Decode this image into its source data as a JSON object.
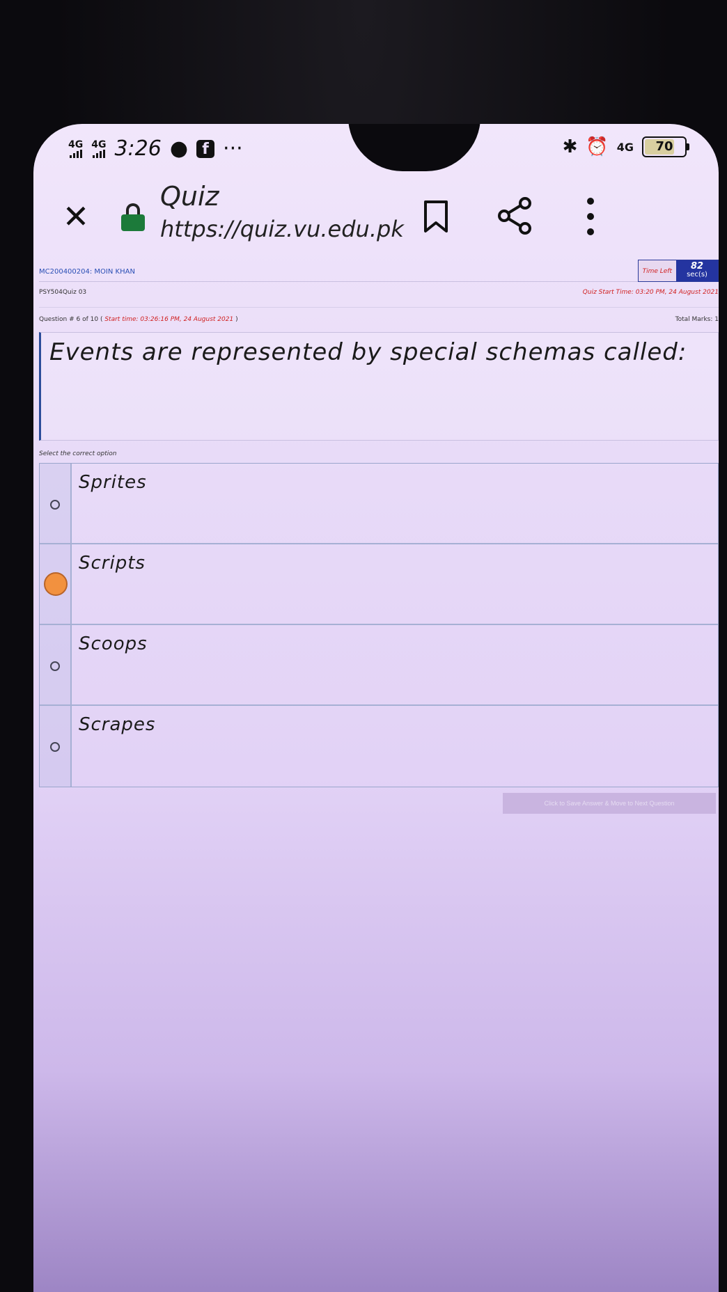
{
  "status_bar": {
    "signal1": "4G",
    "signal2": "4G",
    "time": "3:26",
    "more": "···",
    "network_right": "4G",
    "battery": "70"
  },
  "browser": {
    "title": "Quiz",
    "url": "https://quiz.vu.edu.pk"
  },
  "quiz": {
    "student": "MC200400204: MOIN KHAN",
    "timer_label": "Time Left",
    "timer_value": "82",
    "timer_unit": "sec(s)",
    "course": "PSY504Quiz 03",
    "quiz_start": "Quiz Start Time: 03:20 PM, 24 August 2021",
    "question_num": "Question # 6 of 10 (",
    "question_start": "Start time: 03:26:16 PM, 24 August 2021",
    "question_num_close": ")",
    "total_marks": "Total Marks: 1",
    "question": "Events are represented by special schemas called:",
    "select_label": "Select the correct option",
    "options": [
      "Sprites",
      "Scripts",
      "Scoops",
      "Scrapes"
    ],
    "selected_index": 1,
    "save_button": "Click to Save Answer & Move to Next Question"
  }
}
